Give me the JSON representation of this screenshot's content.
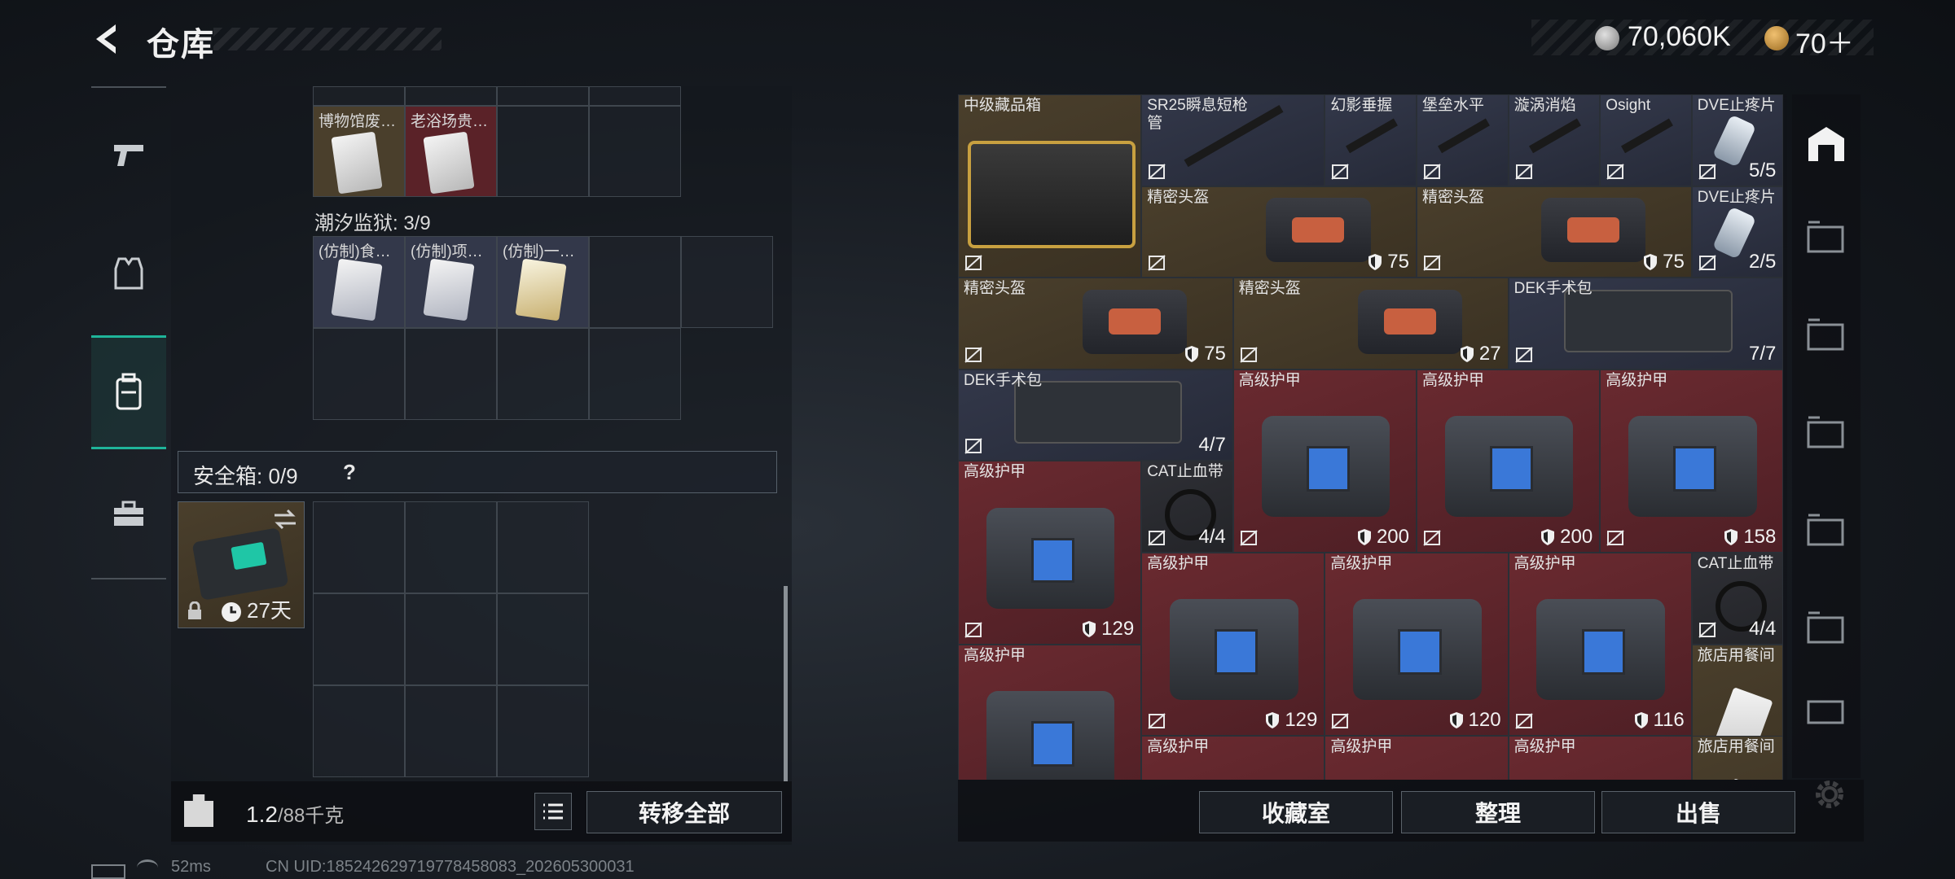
{
  "header": {
    "title": "仓库",
    "coins": "70,060K",
    "tokens": "70＋"
  },
  "left_tabs": [
    "pistol-icon",
    "armor-vest-icon",
    "backpack-icon",
    "toolbox-icon"
  ],
  "stash": {
    "row1_items": [
      "博物馆废…",
      "老浴场贵…"
    ],
    "prison_label": "潮汐监狱: 3/9",
    "prison_items": [
      "(仿制)食…",
      "(仿制)项…",
      "(仿制)一…"
    ]
  },
  "safebox": {
    "label": "安全箱: 0/9",
    "help": "?",
    "days": "27天"
  },
  "bottom_left": {
    "weight": "1.2",
    "capacity": "/88千克",
    "transfer_all": "转移全部"
  },
  "inventory": [
    {
      "name": "中级藏品箱",
      "value": "",
      "color": "gold"
    },
    {
      "name": "SR25瞬息短枪管",
      "value": "",
      "color": "blue"
    },
    {
      "name": "幻影垂握",
      "value": "",
      "color": "blue"
    },
    {
      "name": "堡垒水平",
      "value": "",
      "color": "blue"
    },
    {
      "name": "漩涡消焰",
      "value": "",
      "color": "blue"
    },
    {
      "name": "Osight",
      "value": "",
      "color": "blue"
    },
    {
      "name": "DVE止疼片",
      "value": "5/5",
      "color": "blue"
    },
    {
      "name": "精密头盔",
      "value": "75",
      "color": "gold"
    },
    {
      "name": "精密头盔",
      "value": "75",
      "color": "gold"
    },
    {
      "name": "DVE止疼片",
      "value": "2/5",
      "color": "blue"
    },
    {
      "name": "精密头盔",
      "value": "75",
      "color": "gold"
    },
    {
      "name": "精密头盔",
      "value": "27",
      "color": "gold"
    },
    {
      "name": "DEK手术包",
      "value": "7/7",
      "color": "blue"
    },
    {
      "name": "DEK手术包",
      "value": "4/7",
      "color": "blue"
    },
    {
      "name": "高级护甲",
      "value": "200",
      "color": "red"
    },
    {
      "name": "高级护甲",
      "value": "200",
      "color": "red"
    },
    {
      "name": "高级护甲",
      "value": "158",
      "color": "red"
    },
    {
      "name": "高级护甲",
      "value": "129",
      "color": "red"
    },
    {
      "name": "CAT止血带",
      "value": "4/4",
      "color": "dark"
    },
    {
      "name": "高级护甲",
      "value": "129",
      "color": "red"
    },
    {
      "name": "高级护甲",
      "value": "120",
      "color": "red"
    },
    {
      "name": "高级护甲",
      "value": "116",
      "color": "red"
    },
    {
      "name": "CAT止血带",
      "value": "4/4",
      "color": "dark"
    },
    {
      "name": "高级护甲",
      "value": "",
      "color": "red"
    },
    {
      "name": "旅店用餐间",
      "value": "",
      "color": "gold"
    },
    {
      "name": "高级护甲",
      "value": "",
      "color": "red"
    },
    {
      "name": "高级护甲",
      "value": "",
      "color": "red"
    },
    {
      "name": "高级护甲",
      "value": "",
      "color": "red"
    },
    {
      "name": "旅店用餐间",
      "value": "",
      "color": "gold"
    }
  ],
  "bottom_right": {
    "collection": "收藏室",
    "sort": "整理",
    "sell": "出售"
  },
  "status_bar": {
    "ping": "52ms",
    "uid": "CN UID:185242629719778458083_202605300031"
  }
}
